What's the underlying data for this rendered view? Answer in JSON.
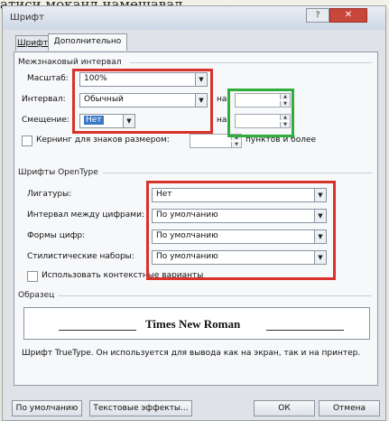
{
  "background_text": "атиcи моканд намешавад.",
  "window": {
    "title": "Шрифт",
    "help": "?",
    "close": "✕"
  },
  "tabs": [
    "Шрифт",
    "Дополнительно"
  ],
  "spacing": {
    "heading": "Межзнаковый интервал",
    "scale_label": "Масштаб:",
    "scale_value": "100%",
    "interval_label": "Интервал:",
    "interval_value": "Обычный",
    "offset_label": "Смещение:",
    "offset_value": "Нет",
    "by_label_1": "на:",
    "by_label_2": "на:",
    "kerning_label": "Кернинг для знаков размером:",
    "kerning_suffix": "пунктов и более"
  },
  "opentype": {
    "heading": "Шрифты OpenType",
    "ligatures_label": "Лигатуры:",
    "ligatures_value": "Нет",
    "num_spacing_label": "Интервал между цифрами:",
    "num_spacing_value": "По умолчанию",
    "num_forms_label": "Формы цифр:",
    "num_forms_value": "По умолчанию",
    "stylistic_label": "Стилистические наборы:",
    "stylistic_value": "По умолчанию",
    "contextual_label": "Использовать контекстные варианты"
  },
  "sample": {
    "heading": "Образец",
    "text": "Times New Roman",
    "description": "Шрифт TrueType. Он используется для вывода как на экран, так и на принтер."
  },
  "buttons": {
    "default": "По умолчанию",
    "effects": "Текстовые эффекты...",
    "ok": "ОК",
    "cancel": "Отмена"
  },
  "colors": {
    "highlight_red": "#d8322a",
    "highlight_green": "#2fae3b",
    "selection": "#3a78c8"
  }
}
